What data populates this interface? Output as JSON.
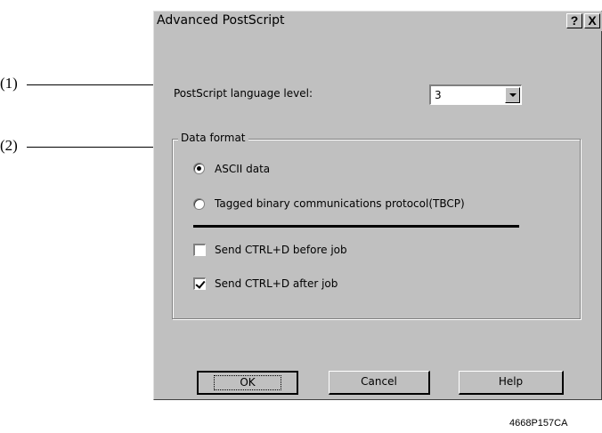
{
  "callouts": [
    {
      "label": "(1)"
    },
    {
      "label": "(2)"
    }
  ],
  "dialog": {
    "title": "Advanced PostScript",
    "help_glyph": "?",
    "close_glyph": "X"
  },
  "language_level": {
    "label": "PostScript language level:",
    "selected_value": "3"
  },
  "data_format": {
    "legend": "Data format",
    "options": [
      {
        "label": "ASCII data",
        "checked": true
      },
      {
        "label": "Tagged binary communications protocol(TBCP)",
        "checked": false
      }
    ],
    "checkboxes": [
      {
        "label": "Send CTRL+D before job",
        "checked": false
      },
      {
        "label": "Send CTRL+D after job",
        "checked": true
      }
    ]
  },
  "buttons": {
    "ok": "OK",
    "cancel": "Cancel",
    "help": "Help"
  },
  "figure_code": "4668P157CA"
}
